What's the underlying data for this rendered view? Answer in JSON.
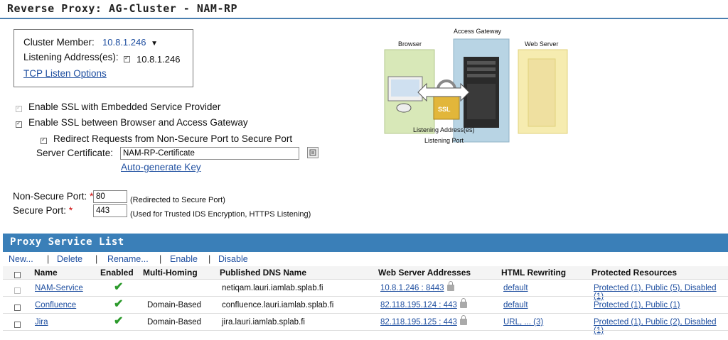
{
  "page_title": "Reverse Proxy: AG-Cluster - NAM-RP",
  "cluster": {
    "member_label": "Cluster Member:",
    "member_value": "10.8.1.246",
    "listening_label": "Listening Address(es):",
    "listening_value": "10.8.1.246",
    "tcp_link": "TCP Listen Options"
  },
  "ssl": {
    "embedded_sp_label": "Enable SSL with Embedded Service Provider",
    "browser_ag_label": "Enable SSL between Browser and Access Gateway",
    "redirect_label": "Redirect Requests from Non-Secure Port to Secure Port",
    "server_cert_label": "Server Certificate:",
    "server_cert_value": "NAM-RP-Certificate",
    "auto_generate_link": "Auto-generate Key"
  },
  "ports": {
    "non_secure_label": "Non-Secure Port:",
    "non_secure_value": "80",
    "non_secure_note": "(Redirected to Secure Port)",
    "secure_label": "Secure Port:",
    "secure_value": "443",
    "secure_note": "(Used for Trusted IDS Encryption, HTTPS Listening)",
    "required_mark": "*"
  },
  "diagram": {
    "access_gateway": "Access Gateway",
    "browser": "Browser",
    "web_server": "Web Server",
    "listening_address": "Listening Address(es)",
    "listening_port": "Listening Port",
    "ssl": "SSL"
  },
  "proxy_list": {
    "title": "Proxy Service List",
    "toolbar": {
      "new": "New...",
      "delete": "Delete",
      "rename": "Rename...",
      "enable": "Enable",
      "disable": "Disable",
      "sep": "|"
    },
    "headers": {
      "name": "Name",
      "enabled": "Enabled",
      "multi_homing": "Multi-Homing",
      "dns": "Published DNS Name",
      "web_server": "Web Server Addresses",
      "html_rewriting": "HTML Rewriting",
      "protected": "Protected Resources"
    },
    "rows": [
      {
        "name": "NAM-Service",
        "multi_homing": "",
        "dns": "netiqam.lauri.iamlab.splab.fi",
        "web_server": "10.8.1.246 : 8443",
        "html_rewriting": "default",
        "protected": "Protected (1), Public (5), Disabled (1)"
      },
      {
        "name": "Confluence",
        "multi_homing": "Domain-Based",
        "dns": "confluence.lauri.iamlab.splab.fi",
        "web_server": "82.118.195.124 : 443",
        "html_rewriting": "default",
        "protected": "Protected (1), Public (1)"
      },
      {
        "name": "Jira",
        "multi_homing": "Domain-Based",
        "dns": "jira.lauri.iamlab.splab.fi",
        "web_server": "82.118.195.125 : 443",
        "html_rewriting": "URL, ... (3)",
        "protected": "Protected (1), Public (2), Disabled (1)"
      }
    ]
  }
}
